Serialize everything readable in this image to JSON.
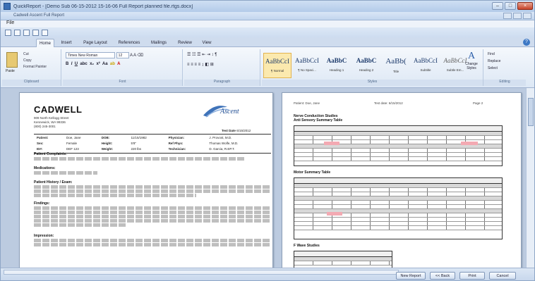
{
  "window": {
    "title": "QuickReport - [Demo Sub 06-15-2012 15-16-06 Full Report planned file.rtgs.docx]",
    "inner_title": "Cadwell Ascent Full Report",
    "menu_label": "File"
  },
  "ribbon": {
    "tabs": [
      "Home",
      "Insert",
      "Page Layout",
      "References",
      "Mailings",
      "Review",
      "View"
    ],
    "active_tab": "Home",
    "clipboard": {
      "paste": "Paste",
      "cut": "Cut",
      "copy": "Copy",
      "format_painter": "Format Painter",
      "label": "Clipboard"
    },
    "font": {
      "name": "Times New Roman",
      "size": "12",
      "label": "Font"
    },
    "paragraph": {
      "label": "Paragraph"
    },
    "styles": {
      "label": "Styles",
      "items": [
        {
          "sample": "AaBbCcI",
          "name": "¶ Normal"
        },
        {
          "sample": "AaBbCcI",
          "name": "¶ No Spaci..."
        },
        {
          "sample": "AaBbC",
          "name": "Heading 1"
        },
        {
          "sample": "AaBbC",
          "name": "Heading 2"
        },
        {
          "sample": "AaBb(",
          "name": "Title"
        },
        {
          "sample": "AaBbCcI",
          "name": "Subtitle"
        },
        {
          "sample": "AaBbCcI",
          "name": "Subtle Em..."
        }
      ],
      "change_styles": "Change Styles"
    },
    "editing": {
      "label": "Editing",
      "find": "Find",
      "replace": "Replace",
      "select": "Select"
    }
  },
  "left_page": {
    "logo": "CADWELL",
    "address": [
      "909 North Kellogg Street",
      "Kennewick, WA 99336",
      "(800) 245-3001"
    ],
    "product": "Ascent",
    "test_date_label": "Test Date",
    "test_date": "6/15/2012",
    "patient": [
      [
        "Patient:",
        "Doe, Jane",
        "DOB:",
        "11/15/1982",
        "Physician:",
        "J. Provost, M.D."
      ],
      [
        "Sex:",
        "Female",
        "Height:",
        "5'8\"",
        "Ref Phys:",
        "Thomas Wolfe, M.D."
      ],
      [
        "ID#:",
        "DEF 123",
        "Weight:",
        "220 lbs",
        "Technician:",
        "D. Garcia, R.EP.T."
      ]
    ],
    "sections": [
      "Patient Complaints:",
      "Medications:",
      "Patient History / Exam:",
      "Findings:",
      "Impression:"
    ]
  },
  "right_page": {
    "header_left": "Patient: Doe, Jane",
    "header_mid": "Test date: 6/15/2012",
    "header_right": "Page 2",
    "sections": [
      "Nerve Conduction Studies",
      "Anti Sensory Summary Table",
      "Motor Summary Table",
      "F Wave Studies"
    ]
  },
  "status": {
    "buttons": [
      "New Report",
      "<< Back",
      "Print",
      "Cancel"
    ]
  }
}
